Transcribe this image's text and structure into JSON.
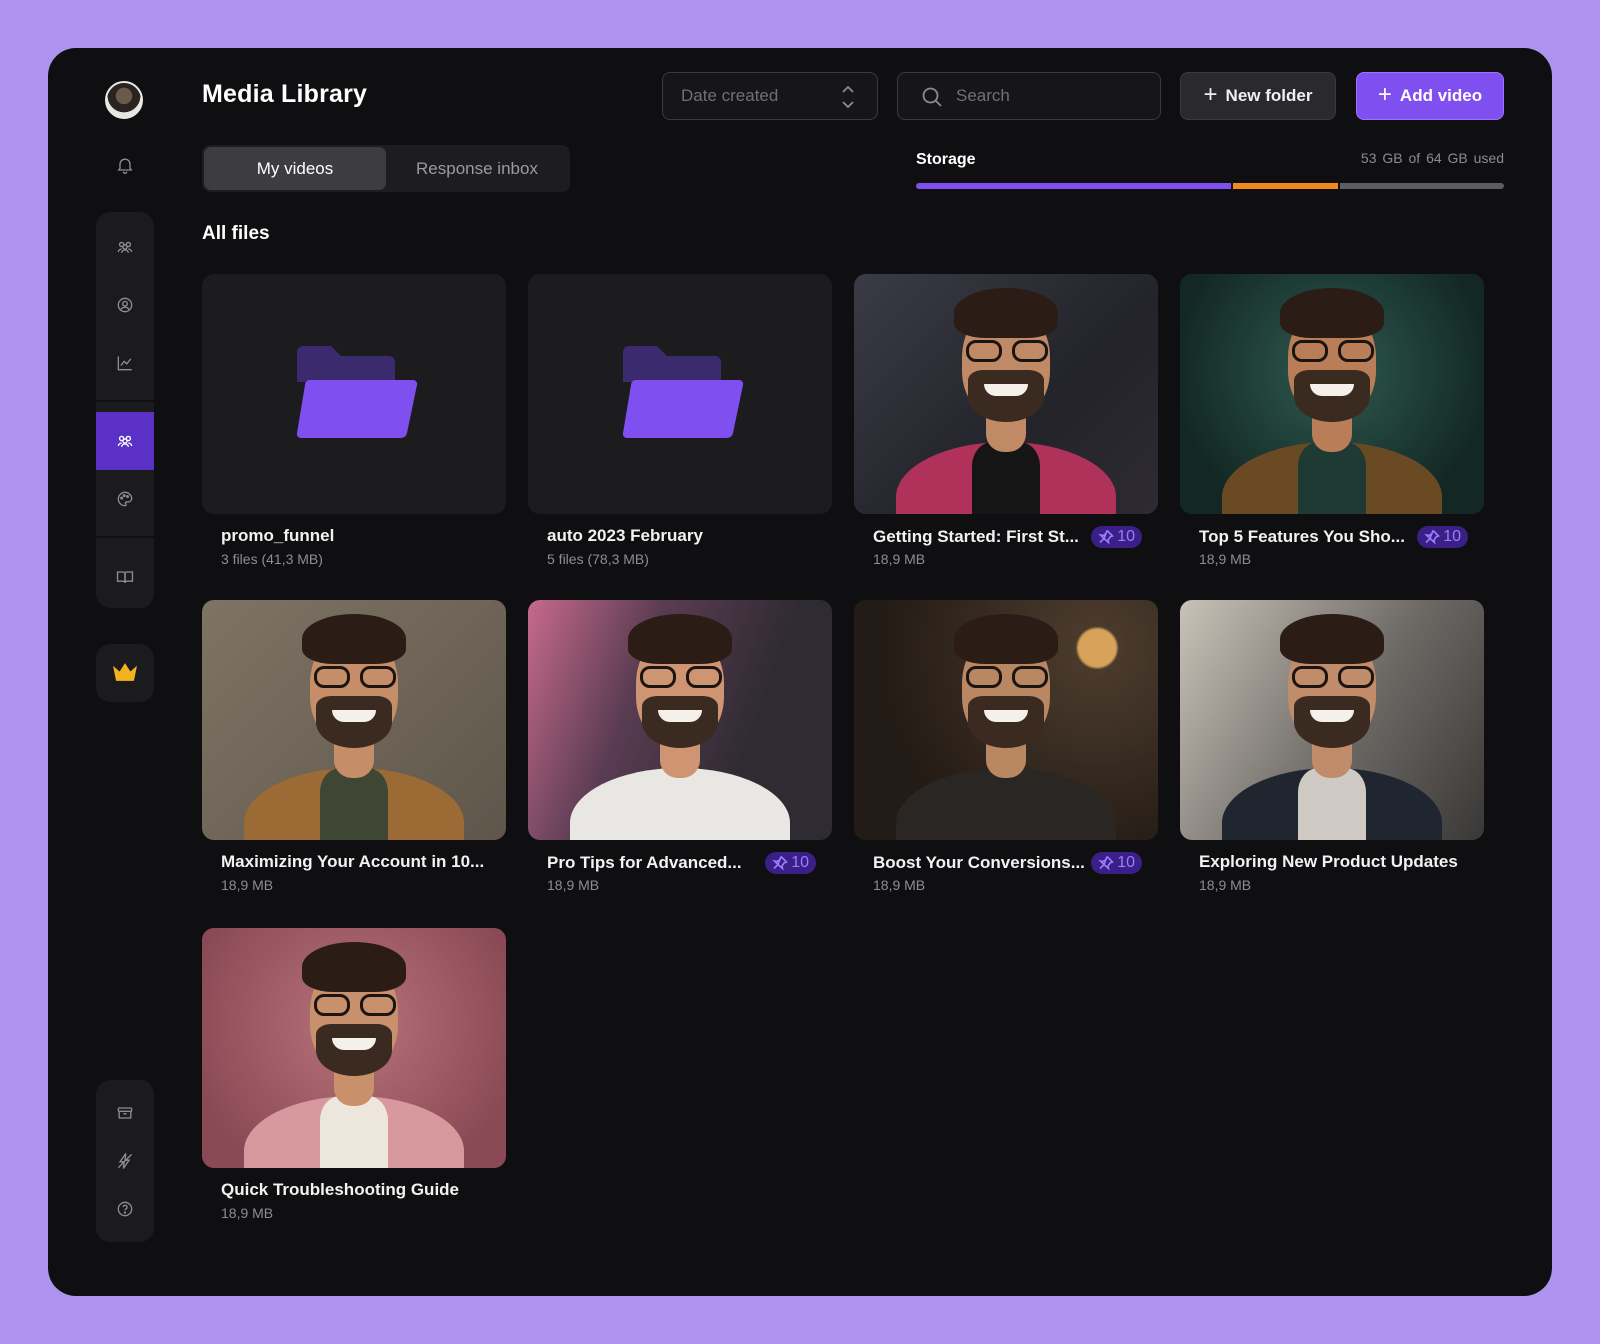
{
  "header": {
    "title": "Media Library",
    "sort": {
      "placeholder": "Date created"
    },
    "search": {
      "placeholder": "Search"
    },
    "new_folder_label": "New folder",
    "add_video_label": "Add video"
  },
  "tabs": [
    {
      "label": "My videos",
      "active": true
    },
    {
      "label": "Response inbox",
      "active": false
    }
  ],
  "storage": {
    "label": "Storage",
    "used": "53 GB of",
    "total": "64 GB used",
    "segments": [
      {
        "fraction": 0.54,
        "color": "#7f4ff0"
      },
      {
        "fraction": 0.18,
        "color": "#f08a1c"
      },
      {
        "fraction": 0.28,
        "color": "#5c5c61"
      }
    ]
  },
  "section_title": "All files",
  "sidebar": {
    "icons": [
      "bell-icon",
      "team-icon",
      "user-circle-icon",
      "chart-icon",
      "team-active-icon",
      "palette-icon",
      "book-icon",
      "crown-icon",
      "archive-icon",
      "lightning-icon",
      "help-icon"
    ]
  },
  "items": [
    {
      "kind": "folder",
      "title": "promo_funnel",
      "meta": "3 files (41,3 MB)"
    },
    {
      "kind": "folder",
      "title": "auto 2023 February",
      "meta": "5 files (78,3 MB)"
    },
    {
      "kind": "video",
      "title": "Getting Started: First St...",
      "meta": "18,9 MB",
      "badge": "10"
    },
    {
      "kind": "video",
      "title": "Top 5 Features You Sho...",
      "meta": "18,9 MB",
      "badge": "10"
    },
    {
      "kind": "video",
      "title": "Maximizing Your Account in 10...",
      "meta": "18,9 MB"
    },
    {
      "kind": "video",
      "title": "Pro Tips for Advanced...",
      "meta": "18,9 MB",
      "badge": "10"
    },
    {
      "kind": "video",
      "title": "Boost Your Conversions...",
      "meta": "18,9 MB",
      "badge": "10"
    },
    {
      "kind": "video",
      "title": "Exploring New Product Updates",
      "meta": "18,9 MB"
    },
    {
      "kind": "video",
      "title": "Quick Troubleshooting Guide",
      "meta": "18,9 MB"
    }
  ],
  "colors": {
    "accent": "#7f4ff0",
    "folder": "#7f4ff0",
    "crown": "#f3b21f"
  }
}
